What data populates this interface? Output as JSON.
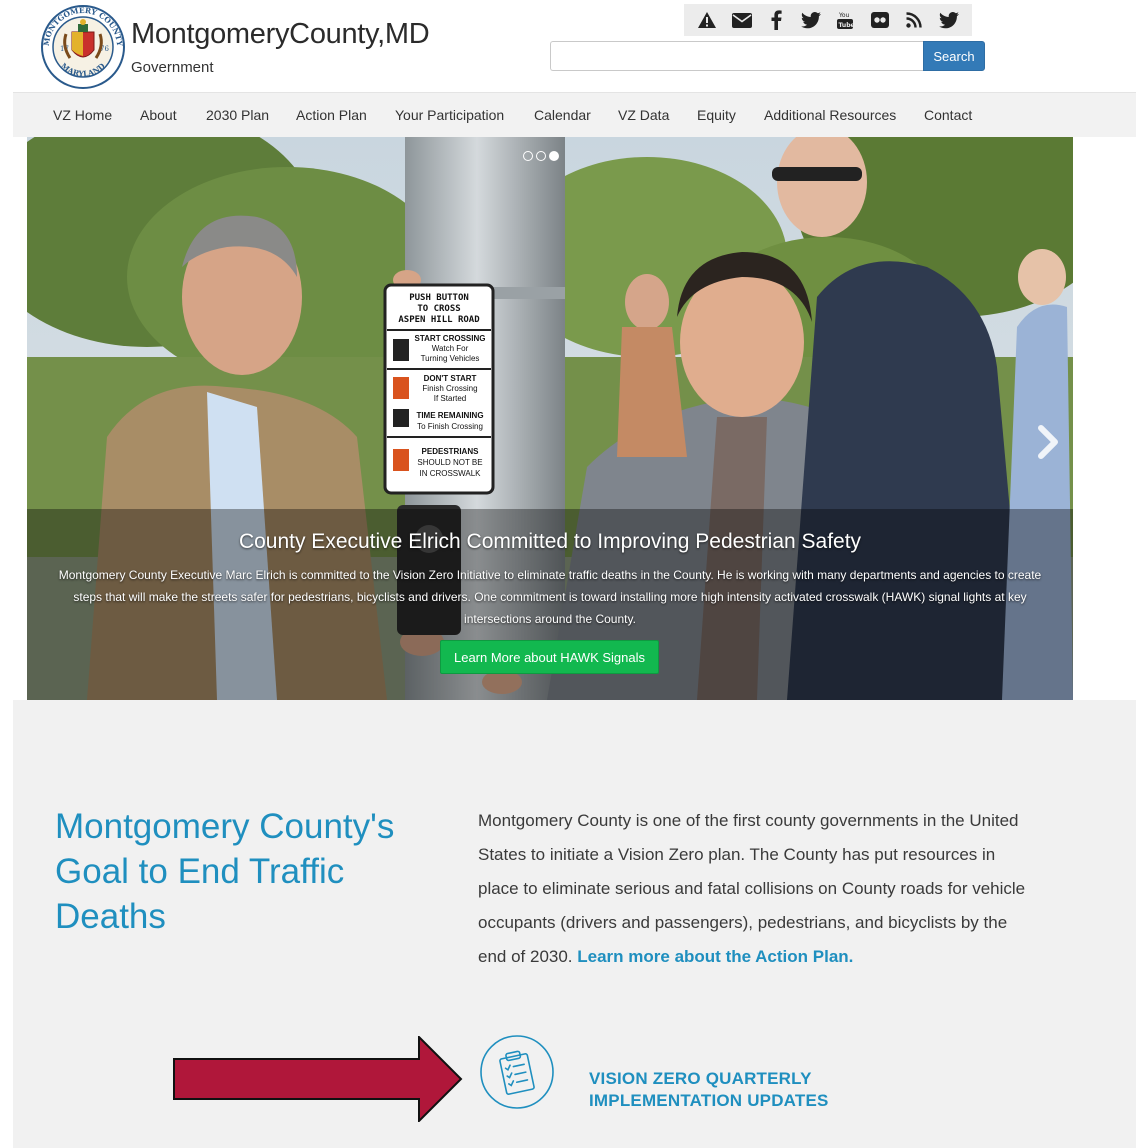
{
  "header": {
    "title": "MontgomeryCounty,MD",
    "subtitle": "Government",
    "seal": {
      "top_text": "MONTGOMERY COUNTY",
      "bottom_text": "MARYLAND",
      "year_left": "17",
      "year_right": "76"
    },
    "social_icons": [
      "alert-icon",
      "mail-icon",
      "facebook-icon",
      "twitter-icon",
      "youtube-icon",
      "flickr-icon",
      "rss-icon",
      "twitter-icon"
    ],
    "search": {
      "placeholder": "",
      "value": "",
      "button_label": "Search"
    }
  },
  "nav": {
    "items": [
      "VZ Home",
      "About",
      "2030 Plan",
      "Action Plan",
      "Your Participation",
      "Calendar",
      "VZ Data",
      "Equity",
      "Additional Resources",
      "Contact"
    ]
  },
  "hero": {
    "active_slide": 3,
    "slide_count": 3,
    "sign": {
      "line1": "PUSH BUTTON",
      "line2": "TO CROSS",
      "line3": "ASPEN HILL ROAD",
      "line4": "START CROSSING",
      "line5": "Watch For",
      "line6": "Turning Vehicles",
      "line7": "DON'T START",
      "line8": "Finish Crossing",
      "line9": "If Started",
      "line10": "TIME REMAINING",
      "line11": "To Finish Crossing",
      "line12": "PEDESTRIANS",
      "line13": "SHOULD NOT BE",
      "line14": "IN CROSSWALK"
    },
    "caption_title": "County Executive Elrich Committed to Improving Pedestrian Safety",
    "caption_text": "Montgomery County Executive Marc Elrich is committed to the Vision Zero Initiative to eliminate traffic deaths in the County. He is working with many departments and agencies to create steps that will make the streets safer for pedestrians, bicyclists and drivers. One commitment is toward installing more high intensity activated crosswalk (HAWK) signal lights at key intersections around the County.",
    "button_label": "Learn More about HAWK Signals",
    "colors": {
      "button": "#12b84f"
    }
  },
  "goal": {
    "title": "Montgomery County's Goal to End Traffic Deaths",
    "text": "Montgomery County is one of the first county governments in the United States to initiate a Vision Zero plan. The County has put resources in place to eliminate serious and fatal collisions on County roads for vehicle occupants (drivers and passengers), pedestrians, and bicyclists by the end of 2030.",
    "link_label": "Learn more about the Action Plan.",
    "colors": {
      "heading": "#1f8fbf",
      "annotation_arrow": "#b0173a"
    }
  },
  "updates": {
    "icon": "clipboard-checklist-icon",
    "label": "VISION ZERO QUARTERLY IMPLEMENTATION UPDATES"
  }
}
